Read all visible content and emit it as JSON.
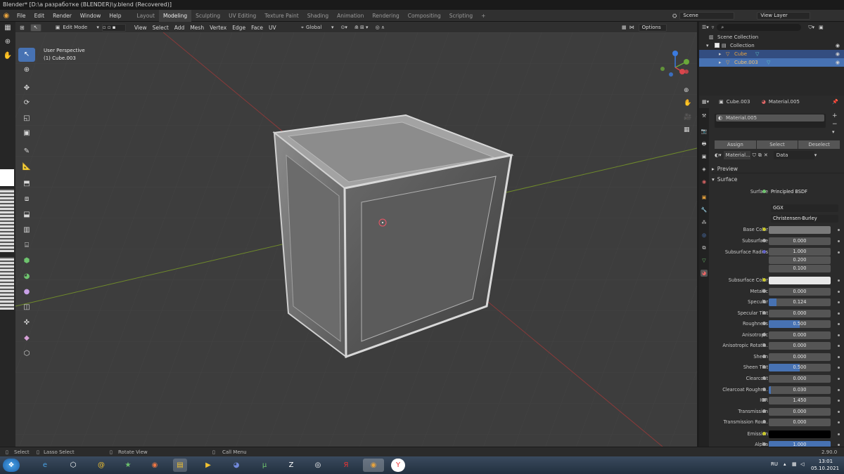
{
  "window": {
    "title": "Blender* [D:\\а разработке (BLENDER)\\y.blend (Recovered)]"
  },
  "menu": {
    "items": [
      "File",
      "Edit",
      "Render",
      "Window",
      "Help"
    ]
  },
  "workspaces": [
    "Layout",
    "Modeling",
    "Sculpting",
    "UV Editing",
    "Texture Paint",
    "Shading",
    "Animation",
    "Rendering",
    "Compositing",
    "Scripting"
  ],
  "workspace_active": "Modeling",
  "scene": {
    "name": "Scene",
    "view_layer": "View Layer"
  },
  "viewport": {
    "mode": "Edit Mode",
    "menus": [
      "View",
      "Select",
      "Add",
      "Mesh",
      "Vertex",
      "Edge",
      "Face",
      "UV"
    ],
    "orientation": "Global",
    "options_label": "Options",
    "overlay_line1": "User Perspective",
    "overlay_line2": "(1) Cube.003"
  },
  "outliner": {
    "root": "Scene Collection",
    "collection": "Collection",
    "objects": [
      "Cube",
      "Cube.003"
    ]
  },
  "properties": {
    "object": "Cube.003",
    "material": "Material.005",
    "slot": "Material.005",
    "assign": "Assign",
    "select": "Select",
    "deselect": "Deselect",
    "material_short": "Material...",
    "data_label": "Data",
    "preview": "Preview",
    "surface_panel": "Surface",
    "surface_label": "Surface",
    "surface_value": "Principled BSDF",
    "distribution": "GGX",
    "subsurface_method": "Christensen-Burley",
    "base_color_label": "Base Color",
    "subsurface_color_label": "Subsurface Color",
    "emission_label": "Emission",
    "subsurface_radius_label": "Subsurface Radius",
    "subsurface_radius": [
      "1.000",
      "0.200",
      "0.100"
    ],
    "fields": [
      {
        "label": "Subsurface",
        "value": "0.000",
        "fill": 0
      },
      {
        "label": "Metallic",
        "value": "0.000",
        "fill": 0
      },
      {
        "label": "Specular",
        "value": "0.124",
        "fill": 0.124
      },
      {
        "label": "Specular Tint",
        "value": "0.000",
        "fill": 0
      },
      {
        "label": "Roughness",
        "value": "0.500",
        "fill": 0.5
      },
      {
        "label": "Anisotropic",
        "value": "0.000",
        "fill": 0
      },
      {
        "label": "Anisotropic Rotati...",
        "value": "0.000",
        "fill": 0
      },
      {
        "label": "Sheen",
        "value": "0.000",
        "fill": 0
      },
      {
        "label": "Sheen Tint",
        "value": "0.500",
        "fill": 0.5
      },
      {
        "label": "Clearcoat",
        "value": "0.000",
        "fill": 0
      },
      {
        "label": "Clearcoat Roughn...",
        "value": "0.030",
        "fill": 0.03
      },
      {
        "label": "IOR",
        "value": "1.450",
        "fill": 0
      },
      {
        "label": "Transmission",
        "value": "0.000",
        "fill": 0
      },
      {
        "label": "Transmission Rou...",
        "value": "0.000",
        "fill": 0
      },
      {
        "label": "Alpha",
        "value": "1.000",
        "fill": 1
      }
    ],
    "colors": {
      "base": "#7a7a7a",
      "subsurface": "#e8e8e8",
      "emission": "#000000"
    }
  },
  "statusbar": {
    "select": "Select",
    "lasso": "Lasso Select",
    "rotate": "Rotate View",
    "call_menu": "Call Menu",
    "version": "2.90.0"
  },
  "taskbar": {
    "language": "RU",
    "time": "13:01",
    "date": "05.10.2021"
  }
}
